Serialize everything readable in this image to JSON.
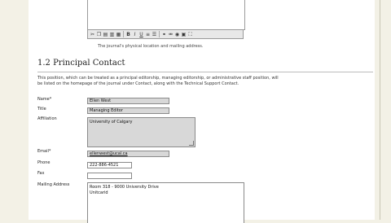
{
  "editor": {
    "toolbar_icons": [
      "cut-icon",
      "copy-icon",
      "paste-icon",
      "paste-text-icon",
      "paste-word-icon",
      "bold-icon",
      "italic-icon",
      "underline-icon",
      "bullet-list-icon",
      "numbered-list-icon",
      "link-icon",
      "unlink-icon",
      "html-icon",
      "image-icon",
      "fullscreen-icon"
    ]
  },
  "editor_caption": "The journal's physical location and mailing address.",
  "section": {
    "title": "1.2 Principal Contact",
    "description": "This position, which can be treated as a principal editorship, managing editorship, or administrative staff position, will be listed on the homepage of the journal under Contact, along with the Technical Support Contact."
  },
  "form": {
    "name_label": "Name*",
    "name_value": "Ellen West",
    "title_label": "Title",
    "title_value": "Managing Editor",
    "affiliation_label": "Affiliation",
    "affiliation_value": "University of Calgary",
    "email_label": "Email*",
    "email_value": "ellenwest@ucal.ca",
    "phone_label": "Phone",
    "phone_value": "222-886-4521",
    "fax_label": "Fax",
    "fax_value": "",
    "address_label": "Mailing Address",
    "address_line1": "Room 318 - 9000 University Drive",
    "address_line2": "Unitcarid"
  }
}
